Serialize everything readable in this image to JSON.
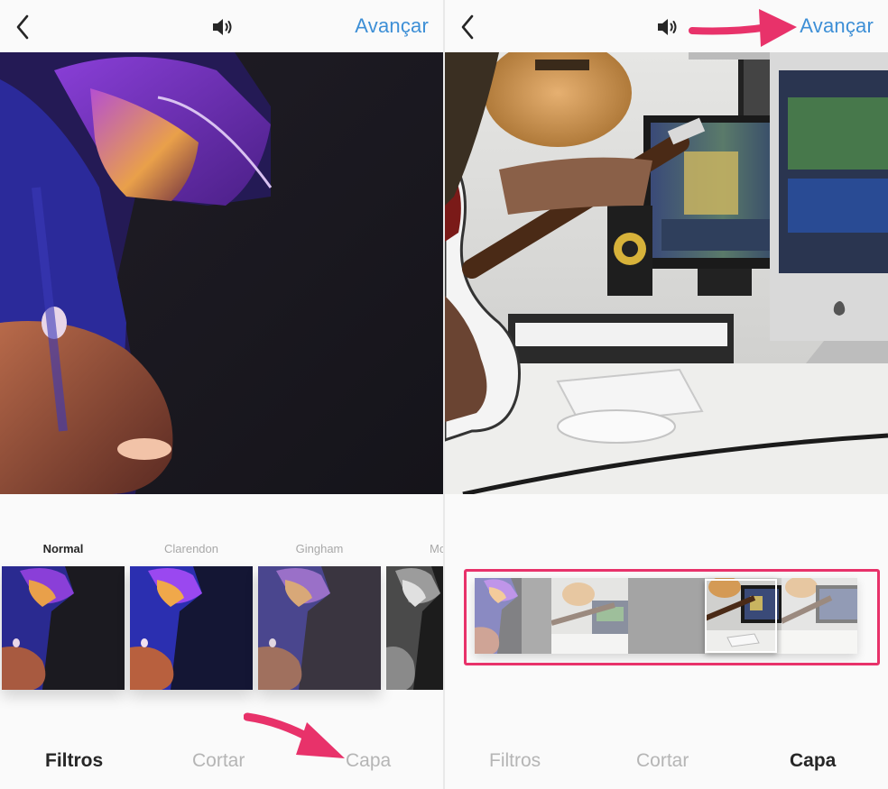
{
  "left_screen": {
    "header": {
      "next_label": "Avançar"
    },
    "filters": [
      {
        "label": "Normal",
        "selected": true
      },
      {
        "label": "Clarendon",
        "selected": false
      },
      {
        "label": "Gingham",
        "selected": false
      },
      {
        "label": "Mo",
        "selected": false
      }
    ],
    "tabs": [
      {
        "label": "Filtros",
        "active": true
      },
      {
        "label": "Cortar",
        "active": false
      },
      {
        "label": "Capa",
        "active": false
      }
    ]
  },
  "right_screen": {
    "header": {
      "next_label": "Avançar"
    },
    "cover_frames_count": 5,
    "selected_cover_frame": 4,
    "tabs": [
      {
        "label": "Filtros",
        "active": false
      },
      {
        "label": "Cortar",
        "active": false
      },
      {
        "label": "Capa",
        "active": true
      }
    ]
  },
  "colors": {
    "accent_link": "#3d8fd6",
    "annotation_pink": "#e8326a",
    "tab_active": "#262626",
    "tab_inactive": "#b5b5b5"
  },
  "icons": [
    "chevron-left-icon",
    "speaker-icon",
    "annotation-arrow"
  ]
}
